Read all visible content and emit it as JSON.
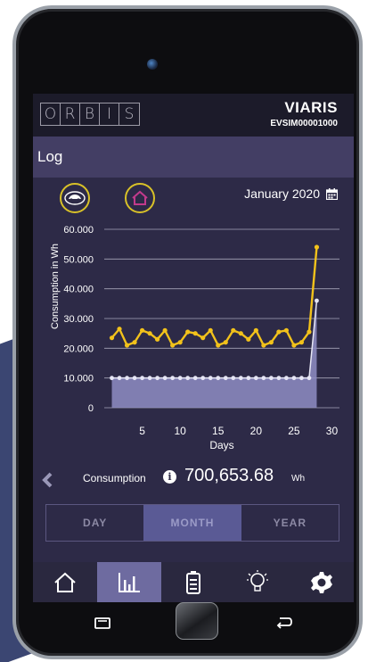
{
  "header": {
    "logo_letters": [
      "O",
      "R",
      "B",
      "I",
      "S"
    ],
    "brand": "VIARIS",
    "device_id": "EVSIM00001000"
  },
  "page": {
    "title": "Log"
  },
  "filters": {
    "icons": [
      "car-icon",
      "home-icon"
    ],
    "date": "January 2020",
    "date_icon": "calendar-icon"
  },
  "chart_data": {
    "type": "area",
    "ylabel": "Consumption in Wh",
    "xlabel": "Days",
    "yticks": [
      "0",
      "10.000",
      "20.000",
      "30.000",
      "40.000",
      "50.000",
      "60.000"
    ],
    "xticks": [
      "5",
      "10",
      "15",
      "20",
      "25",
      "30"
    ],
    "ylim": [
      0,
      60000
    ],
    "xlim": [
      0,
      31
    ],
    "grid": true,
    "series": [
      {
        "color": "#f2c21b",
        "x": [
          1,
          2,
          3,
          4,
          5,
          6,
          7,
          8,
          9,
          10,
          11,
          12,
          13,
          14,
          15,
          16,
          17,
          18,
          19,
          20,
          21,
          22,
          23,
          24,
          25,
          26,
          27,
          28
        ],
        "values": [
          23500,
          26500,
          21000,
          22000,
          26000,
          25000,
          23000,
          26000,
          21000,
          22000,
          25500,
          25000,
          23500,
          26000,
          21000,
          22000,
          26000,
          25000,
          23000,
          26000,
          21000,
          22000,
          25500,
          26000,
          21000,
          22000,
          25500,
          54000
        ]
      },
      {
        "color": "#e6e6f5",
        "fill": "#8f8dc4",
        "x": [
          1,
          2,
          3,
          4,
          5,
          6,
          7,
          8,
          9,
          10,
          11,
          12,
          13,
          14,
          15,
          16,
          17,
          18,
          19,
          20,
          21,
          22,
          23,
          24,
          25,
          26,
          27,
          28
        ],
        "values": [
          10000,
          10000,
          10000,
          10000,
          10000,
          10000,
          10000,
          10000,
          10000,
          10000,
          10000,
          10000,
          10000,
          10000,
          10000,
          10000,
          10000,
          10000,
          10000,
          10000,
          10000,
          10000,
          10000,
          10000,
          10000,
          10000,
          10000,
          36000
        ]
      }
    ]
  },
  "consumption": {
    "label": "Consumption",
    "value": "700,653.68",
    "unit": "Wh",
    "info_icon": "i"
  },
  "tabs": [
    {
      "label": "DAY"
    },
    {
      "label": "MONTH",
      "active": true
    },
    {
      "label": "YEAR"
    }
  ],
  "navbar": {
    "items": [
      "home-icon",
      "chart-icon",
      "battery-icon",
      "bulb-icon",
      "gear-icon"
    ],
    "active_index": 1
  }
}
